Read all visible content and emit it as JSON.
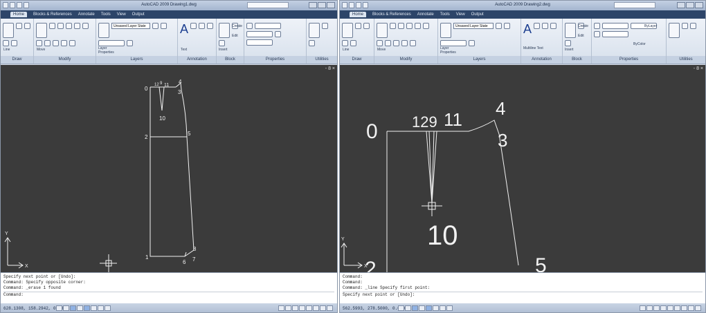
{
  "left": {
    "title": "AutoCAD 2009 Drawing1.dwg",
    "menu_tabs": [
      "Home",
      "Blocks & References",
      "Annotate",
      "Tools",
      "View",
      "Output"
    ],
    "panels": [
      "Draw",
      "Modify",
      "Layers",
      "Annotation",
      "Block",
      "Properties",
      "Utilities"
    ],
    "layer_state": "Unsaved Layer State",
    "tool_labels": {
      "line": "Line",
      "move": "Move",
      "layer": "Layer",
      "properties": "Properties",
      "text": "Text",
      "insert": "Insert",
      "create": "Create",
      "edit": "Edit"
    },
    "viewport_control": "- 8 ×",
    "points": {
      "p0": "0",
      "p1": "1",
      "p2": "2",
      "p3": "3",
      "p4": "4",
      "p5": "5",
      "p6": "6",
      "p7": "7",
      "p8": "8",
      "p9": "9",
      "p10": "10",
      "p11": "11",
      "p12": "12"
    },
    "axis_x": "X",
    "axis_y": "Y",
    "command_lines": [
      "Specify next point or [Undo]:",
      "Command: Specify opposite corner:",
      "Command: _erase 1 found"
    ],
    "command_prompt": "Command:",
    "coords": "628.1308, 158.2942, 0.0000"
  },
  "right": {
    "title": "AutoCAD 2009 Drawing2.dwg",
    "menu_tabs": [
      "Home",
      "Blocks & References",
      "Annotate",
      "Tools",
      "View",
      "Output"
    ],
    "panels": [
      "Draw",
      "Modify",
      "Layers",
      "Annotation",
      "Block",
      "Properties",
      "Utilities"
    ],
    "layer_state": "Unsaved Layer State",
    "tool_labels": {
      "line": "Line",
      "move": "Move",
      "layer": "Layer",
      "properties": "Properties",
      "multiline_text": "Multiline Text",
      "insert": "Insert",
      "create": "Create",
      "edit": "Edit",
      "bylayer": "ByLayer",
      "bycolor": "ByColor"
    },
    "viewport_control": "- 8 ×",
    "points": {
      "p0": "0",
      "p2": "2",
      "p3": "3",
      "p4": "4",
      "p5": "5",
      "p10": "10",
      "p11": "11",
      "p129": "129"
    },
    "axis_x": "X",
    "axis_y": "Y",
    "command_lines": [
      "Command:",
      "Command:",
      "Command:  _line Specify first point:"
    ],
    "command_prompt": "Specify next point or [Undo]:",
    "coords": "562.5993, 278.5000, 0.0000"
  }
}
